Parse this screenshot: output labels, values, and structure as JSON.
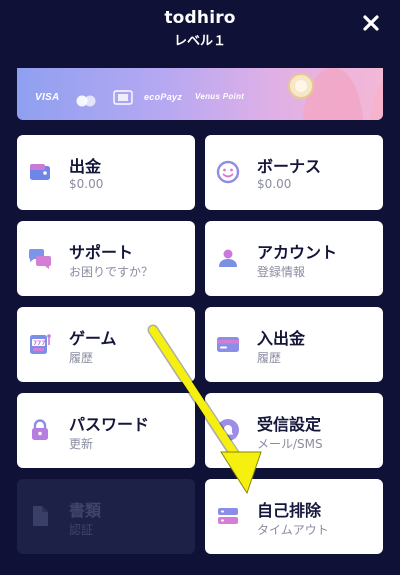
{
  "header": {
    "username": "todhiro",
    "level": "レベル１"
  },
  "banner": {
    "payment_methods": [
      "VISA",
      "",
      "",
      "ecoPayz",
      "Venus Point"
    ]
  },
  "cards": [
    {
      "title": "出金",
      "sub": "$0.00",
      "icon": "wallet-icon",
      "enabled": true
    },
    {
      "title": "ボーナス",
      "sub": "$0.00",
      "icon": "smiley-icon",
      "enabled": true
    },
    {
      "title": "サポート",
      "sub": "お困りですか？",
      "icon": "chat-bubbles-icon",
      "enabled": true
    },
    {
      "title": "アカウント",
      "sub": "登録情報",
      "icon": "user-icon",
      "enabled": true
    },
    {
      "title": "ゲーム",
      "sub": "履歴",
      "icon": "slot-machine-icon",
      "enabled": true
    },
    {
      "title": "入出金",
      "sub": "履歴",
      "icon": "credit-card-icon",
      "enabled": true
    },
    {
      "title": "パスワード",
      "sub": "更新",
      "icon": "padlock-icon",
      "enabled": true
    },
    {
      "title": "受信設定",
      "sub": "メール/SMS",
      "icon": "bell-icon",
      "enabled": true
    },
    {
      "title": "書類",
      "sub": "認証",
      "icon": "document-icon",
      "enabled": false
    },
    {
      "title": "自己排除",
      "sub": "タイムアウト",
      "icon": "self-exclusion-icon",
      "enabled": true
    }
  ],
  "colors": {
    "background": "#0f1236",
    "card": "#ffffff",
    "card_disabled": "#1d2148",
    "arrow": "#f5f00f"
  }
}
